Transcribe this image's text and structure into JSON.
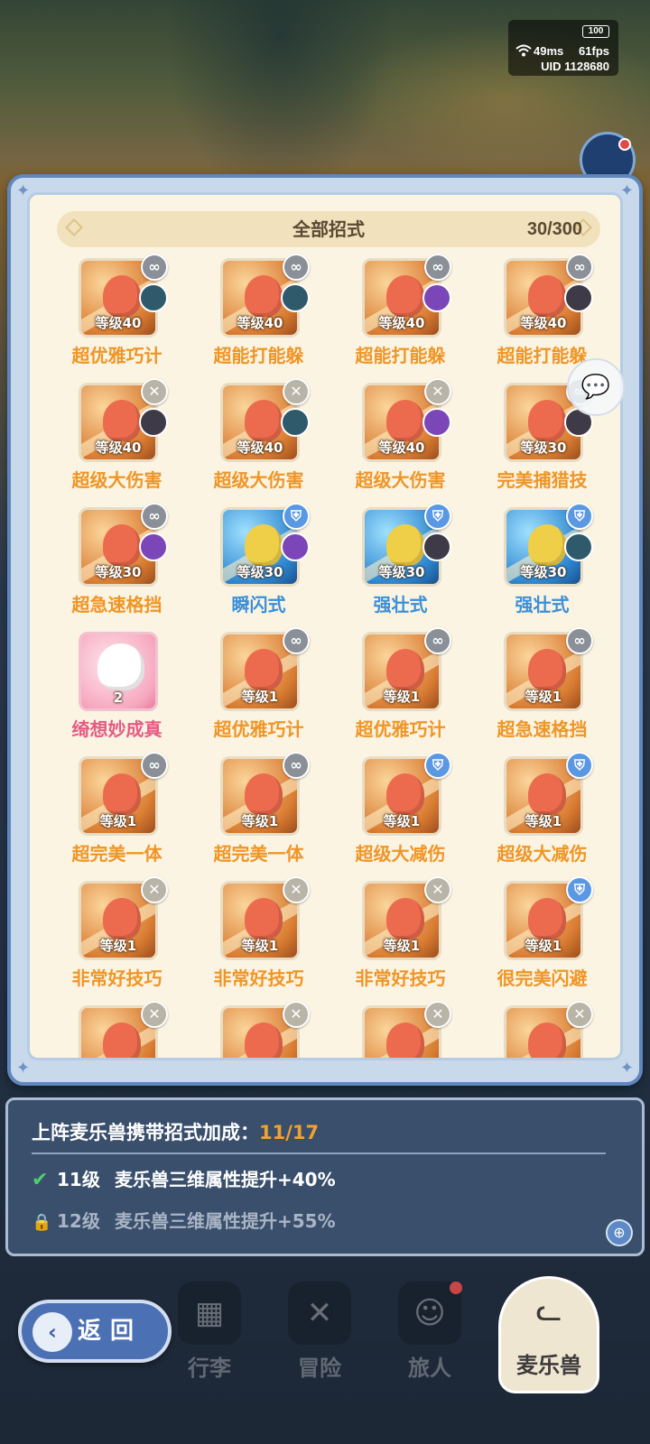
{
  "status": {
    "battery": "100",
    "ping": "49ms",
    "fps": "61fps",
    "uid": "UID 1128680"
  },
  "panel": {
    "title": "全部招式",
    "count": "30/300"
  },
  "skills": [
    {
      "name": "超优雅巧计",
      "level": "等级40",
      "badge": "swap",
      "avatar": "teal",
      "tile": "orange",
      "creature": "red",
      "name_color": "orange"
    },
    {
      "name": "超能打能躲",
      "level": "等级40",
      "badge": "swap",
      "avatar": "teal",
      "tile": "orange",
      "creature": "red",
      "name_color": "orange"
    },
    {
      "name": "超能打能躲",
      "level": "等级40",
      "badge": "swap",
      "avatar": "purple",
      "tile": "orange",
      "creature": "red",
      "name_color": "orange"
    },
    {
      "name": "超能打能躲",
      "level": "等级40",
      "badge": "swap",
      "avatar": "dark",
      "tile": "orange",
      "creature": "red",
      "name_color": "orange"
    },
    {
      "name": "超级大伤害",
      "level": "等级40",
      "badge": "cross",
      "avatar": "dark",
      "tile": "orange",
      "creature": "red",
      "name_color": "orange"
    },
    {
      "name": "超级大伤害",
      "level": "等级40",
      "badge": "cross",
      "avatar": "teal",
      "tile": "orange",
      "creature": "red",
      "name_color": "orange"
    },
    {
      "name": "超级大伤害",
      "level": "等级40",
      "badge": "cross",
      "avatar": "purple",
      "tile": "orange",
      "creature": "red",
      "name_color": "orange"
    },
    {
      "name": "完美捕猎技",
      "level": "等级30",
      "badge": "swap",
      "avatar": "dark",
      "tile": "orange",
      "creature": "red",
      "name_color": "orange"
    },
    {
      "name": "超急速格挡",
      "level": "等级30",
      "badge": "swap",
      "avatar": "purple",
      "tile": "orange",
      "creature": "red",
      "name_color": "orange"
    },
    {
      "name": "瞬闪式",
      "level": "等级30",
      "badge": "shield",
      "avatar": "purple",
      "tile": "blue",
      "creature": "yellow",
      "name_color": "blue"
    },
    {
      "name": "强壮式",
      "level": "等级30",
      "badge": "shield",
      "avatar": "dark",
      "tile": "blue",
      "creature": "yellow",
      "name_color": "blue"
    },
    {
      "name": "强壮式",
      "level": "等级30",
      "badge": "shield",
      "avatar": "teal",
      "tile": "blue",
      "creature": "yellow",
      "name_color": "blue"
    },
    {
      "name": "绮想妙成真",
      "level": "2",
      "badge": "none",
      "avatar": "none",
      "tile": "pink",
      "creature": "white",
      "name_color": "pink"
    },
    {
      "name": "超优雅巧计",
      "level": "等级1",
      "badge": "swap",
      "avatar": "none",
      "tile": "orange",
      "creature": "red",
      "name_color": "orange"
    },
    {
      "name": "超优雅巧计",
      "level": "等级1",
      "badge": "swap",
      "avatar": "none",
      "tile": "orange",
      "creature": "red",
      "name_color": "orange"
    },
    {
      "name": "超急速格挡",
      "level": "等级1",
      "badge": "swap",
      "avatar": "none",
      "tile": "orange",
      "creature": "red",
      "name_color": "orange"
    },
    {
      "name": "超完美一体",
      "level": "等级1",
      "badge": "swap",
      "avatar": "none",
      "tile": "orange",
      "creature": "red",
      "name_color": "orange"
    },
    {
      "name": "超完美一体",
      "level": "等级1",
      "badge": "swap",
      "avatar": "none",
      "tile": "orange",
      "creature": "red",
      "name_color": "orange"
    },
    {
      "name": "超级大减伤",
      "level": "等级1",
      "badge": "shield",
      "avatar": "none",
      "tile": "orange",
      "creature": "red",
      "name_color": "orange"
    },
    {
      "name": "超级大减伤",
      "level": "等级1",
      "badge": "shield",
      "avatar": "none",
      "tile": "orange",
      "creature": "red",
      "name_color": "orange"
    },
    {
      "name": "非常好技巧",
      "level": "等级1",
      "badge": "cross",
      "avatar": "none",
      "tile": "orange",
      "creature": "red",
      "name_color": "orange"
    },
    {
      "name": "非常好技巧",
      "level": "等级1",
      "badge": "cross",
      "avatar": "none",
      "tile": "orange",
      "creature": "red",
      "name_color": "orange"
    },
    {
      "name": "非常好技巧",
      "level": "等级1",
      "badge": "cross",
      "avatar": "none",
      "tile": "orange",
      "creature": "red",
      "name_color": "orange"
    },
    {
      "name": "很完美闪避",
      "level": "等级1",
      "badge": "shield",
      "avatar": "none",
      "tile": "orange",
      "creature": "red",
      "name_color": "orange"
    },
    {
      "name": "",
      "level": "",
      "badge": "cross",
      "avatar": "none",
      "tile": "orange",
      "creature": "red",
      "name_color": "orange"
    },
    {
      "name": "",
      "level": "",
      "badge": "cross",
      "avatar": "none",
      "tile": "orange",
      "creature": "red",
      "name_color": "orange"
    },
    {
      "name": "",
      "level": "",
      "badge": "cross",
      "avatar": "none",
      "tile": "orange",
      "creature": "red",
      "name_color": "orange"
    },
    {
      "name": "",
      "level": "",
      "badge": "cross",
      "avatar": "none",
      "tile": "orange",
      "creature": "red",
      "name_color": "orange"
    }
  ],
  "bonus": {
    "title": "上阵麦乐兽携带招式加成：",
    "progress": "11/17",
    "rows": [
      {
        "level": "11级",
        "text": "麦乐兽三维属性提升+40%",
        "status": "unlocked"
      },
      {
        "level": "12级",
        "text": "麦乐兽三维属性提升+55%",
        "status": "locked"
      }
    ]
  },
  "nav": {
    "back": "返回",
    "items": [
      {
        "label": "行李",
        "icon": "chest-icon"
      },
      {
        "label": "冒险",
        "icon": "crossed-swords-icon"
      },
      {
        "label": "旅人",
        "icon": "character-icon"
      },
      {
        "label": "麦乐兽",
        "icon": "pet-icon",
        "active": true
      }
    ]
  },
  "colors": {
    "panel_border": "#5f86bd",
    "orange_text": "#ef9526",
    "blue_text": "#3d8fd8",
    "pink_text": "#e65a83",
    "progress_accent": "#f3a12e"
  }
}
